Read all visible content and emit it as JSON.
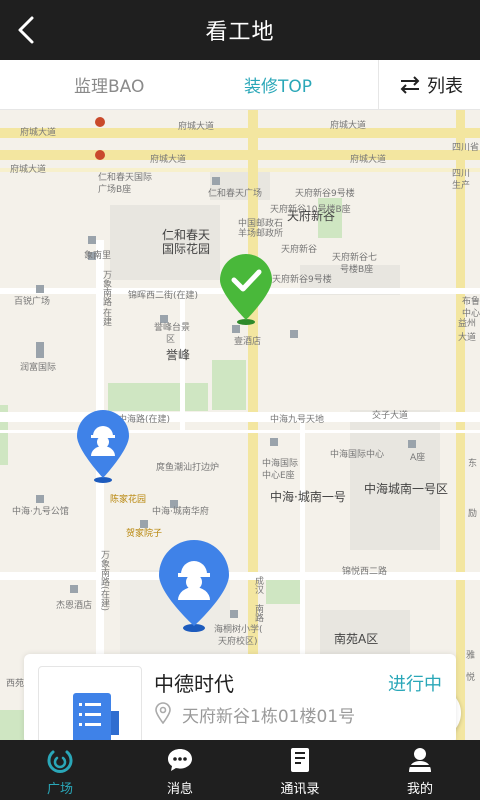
{
  "header": {
    "title": "看工地"
  },
  "tabs": {
    "left": "监理BAO",
    "center": "装修TOP",
    "list_label": "列表"
  },
  "map": {
    "labels": {
      "fucheng1": "府城大道",
      "fucheng2": "府城大道",
      "fucheng3": "府城大道",
      "fucheng4": "府城大道",
      "fucheng5": "府城大道",
      "fucheng6": "府城大道",
      "renhe_plaza1": "仁和春天国际",
      "renhe_plaza2": "广场B座",
      "renhe_plaza3": "仁和春天广场",
      "renhe_garden1": "仁和春天",
      "renhe_garden2": "国际花园",
      "tianfu9": "天府新谷9号楼",
      "tianfu10": "天府新谷10号楼B座",
      "post1": "中国邮政石",
      "post2": "羊场邮政所",
      "xingu": "天府新谷",
      "tianfu_xingu": "天府新谷",
      "xingu7_1": "天府新谷七",
      "xingu7_2": "号楼B座",
      "xingu9_2": "天府新谷9号楼",
      "xiangnanli": "象南里",
      "baiyu": "百锐广场",
      "jinhui": "锦晖西二街(在建)",
      "wanxiang1": "万象南路",
      "wanxiang2": "在建",
      "yufeng_park1": "誉峰台景",
      "yufeng_park2": "区",
      "hotel": "壹酒店",
      "yufeng": "誉峰",
      "rongfu": "润富国际",
      "sichuan1": "四川省",
      "sichuan2": "四川",
      "sichuan3": "生产",
      "buzhe1": "布鲁",
      "buzhe2": "中心",
      "yi1": "益州",
      "yi2": "大道",
      "zhonghai_road": "中海路(在建)",
      "zhonghai9": "中海九号天地",
      "jiaozi": "交子大道",
      "zhonghai_center": "中海国际中心",
      "zhonghai_c1": "中海国际",
      "zhonghai_c2": "中心E座",
      "a_tower": "A座",
      "chen_tower": "陈家花园",
      "kaijia": "庹鱼潮汕打边炉",
      "zhonghai_jiu": "中海·九号公馆",
      "zhonghai_cheng": "中海·城南华府",
      "zhonghai_yihao": "中海·城南一号",
      "zhonghai_yihaoqu": "中海城南一号区",
      "hejia": "贺家院子",
      "jinyang": "锦悦西二路",
      "wanxiang3": "万象南路(在建)",
      "jieao": "杰恩酒店",
      "chenghan1": "成汉",
      "chenghan2": "南路",
      "haitong1": "海桐树小学(",
      "haitong2": "天府校区)",
      "nanyuan": "南苑A区",
      "dong": "东",
      "li": "励",
      "xiyuan": "西苑",
      "ya": "雅",
      "yue": "悦"
    }
  },
  "card": {
    "name": "中德时代",
    "status": "进行中",
    "address": "天府新谷1栋01楼01号"
  },
  "nav": [
    {
      "label": "广场",
      "icon": "plaza-icon"
    },
    {
      "label": "消息",
      "icon": "message-icon"
    },
    {
      "label": "通讯录",
      "icon": "contacts-icon"
    },
    {
      "label": "我的",
      "icon": "profile-icon"
    }
  ],
  "colors": {
    "accent": "#2aa7b8",
    "green_pin": "#49b83a",
    "blue_pin": "#3f82e8",
    "dark_bar": "#1f1f1f"
  }
}
